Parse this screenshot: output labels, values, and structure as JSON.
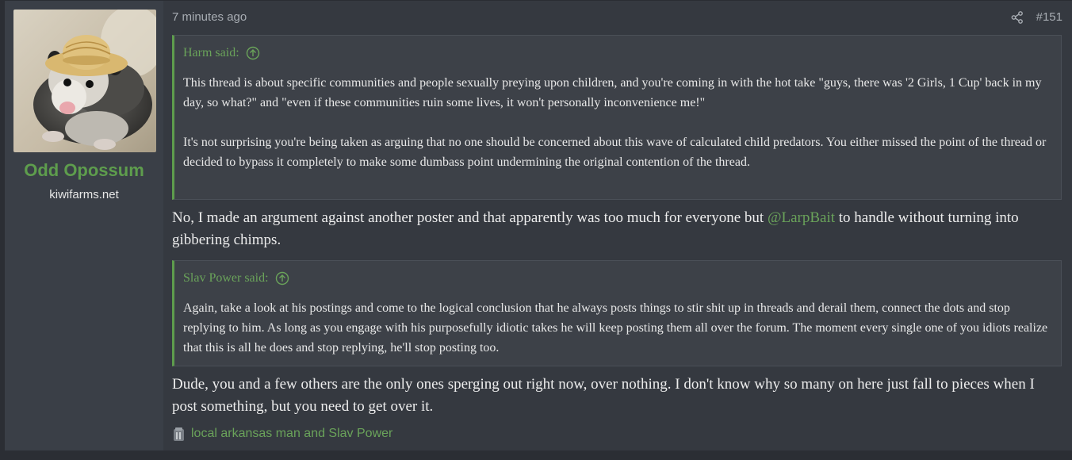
{
  "user": {
    "name": "Odd Opossum",
    "title": "kiwifarms.net",
    "avatar_icon": "opossum-with-straw-hat-avatar"
  },
  "post": {
    "time": "7 minutes ago",
    "number": "#151",
    "share_icon": "share-icon"
  },
  "quotes": [
    {
      "author_said": "Harm said:",
      "paragraphs": [
        "This thread is about specific communities and people sexually preying upon children, and you're coming in with the hot take \"guys, there was '2 Girls, 1 Cup' back in my day, so what?\" and \"even if these communities ruin some lives, it won't personally inconvenience me!\"",
        "It's not surprising you're being taken as arguing that no one should be concerned about this wave of calculated child predators. You either missed the point of the thread or decided to bypass it completely to make some dumbass point undermining the original contention of the thread."
      ]
    },
    {
      "author_said": "Slav Power said:",
      "paragraphs": [
        "Again, take a look at his postings and come to the logical conclusion that he always posts things to stir shit up in threads and derail them, connect the dots and stop replying to him. As long as you engage with his purposefully idiotic takes he will keep posting them all over the forum. The moment every single one of you idiots realize that this is all he does and stop replying, he'll stop posting too."
      ]
    }
  ],
  "replies": [
    {
      "before": "No, I made an argument against another poster and that apparently was too much for everyone but ",
      "mention": "@LarpBait",
      "after": " to handle without turning into gibbering chimps."
    },
    {
      "text": "Dude, you and a few others are the only ones sperging out right now, over nothing. I don't know why so many on here just fall to pieces when I post something, but you need to get over it."
    }
  ],
  "reactions": {
    "icon": "reaction-icon",
    "text": "local arkansas man and Slav Power"
  },
  "colors": {
    "accent_green": "#5e9d4d",
    "post_bg": "#353940",
    "user_cell_bg": "#3a3f47",
    "quote_bg": "#3d4148"
  }
}
